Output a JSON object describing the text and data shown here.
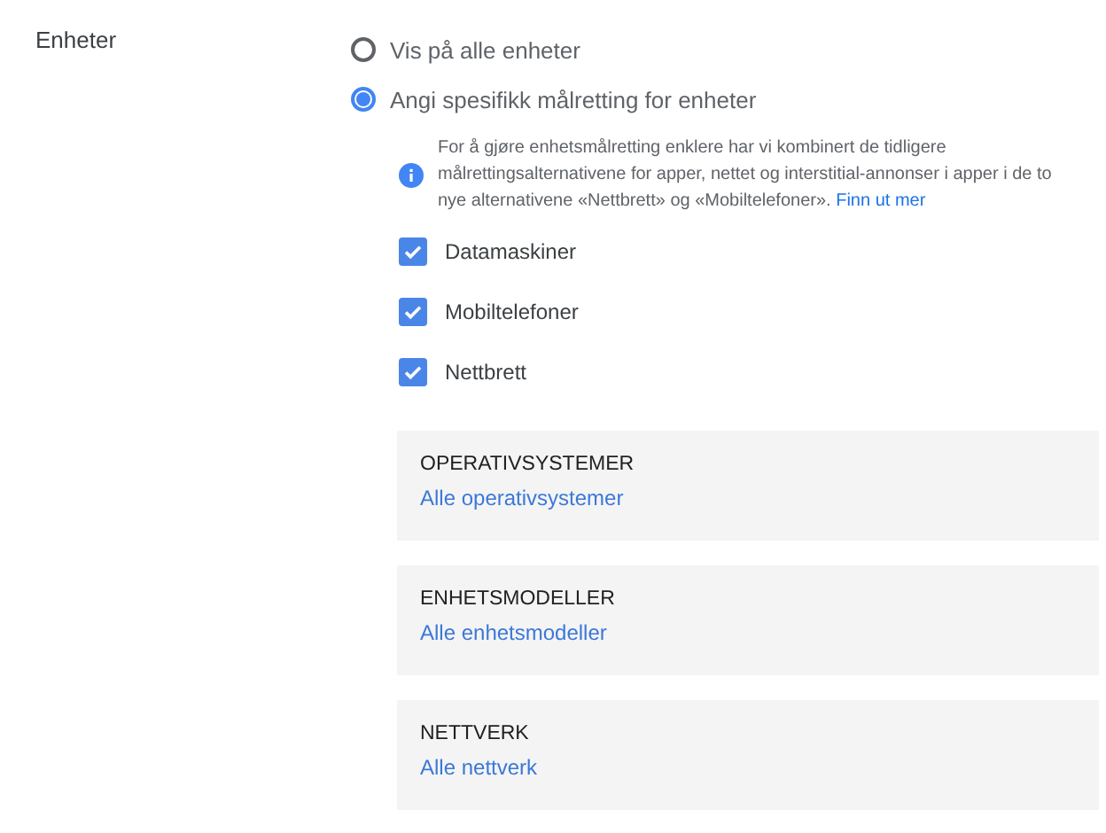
{
  "section_label": "Enheter",
  "options": [
    {
      "label": "Vis på alle enheter",
      "selected": false
    },
    {
      "label": "Angi spesifikk målretting for enheter",
      "selected": true
    }
  ],
  "info": {
    "text": "For å gjøre enhetsmålretting enklere har vi kombinert de tidligere målrettingsalternativene for apper, nettet og interstitial-annonser i apper i de to nye alternativene «Nettbrett» og «Mobiltelefoner».",
    "link": "Finn ut mer"
  },
  "devices": [
    {
      "label": "Datamaskiner",
      "checked": true
    },
    {
      "label": "Mobiltelefoner",
      "checked": true
    },
    {
      "label": "Nettbrett",
      "checked": true
    }
  ],
  "panels": [
    {
      "title": "OPERATIVSYSTEMER",
      "link": "Alle operativsystemer"
    },
    {
      "title": "ENHETSMODELLER",
      "link": "Alle enhetsmodeller"
    },
    {
      "title": "NETTVERK",
      "link": "Alle nettverk"
    }
  ]
}
